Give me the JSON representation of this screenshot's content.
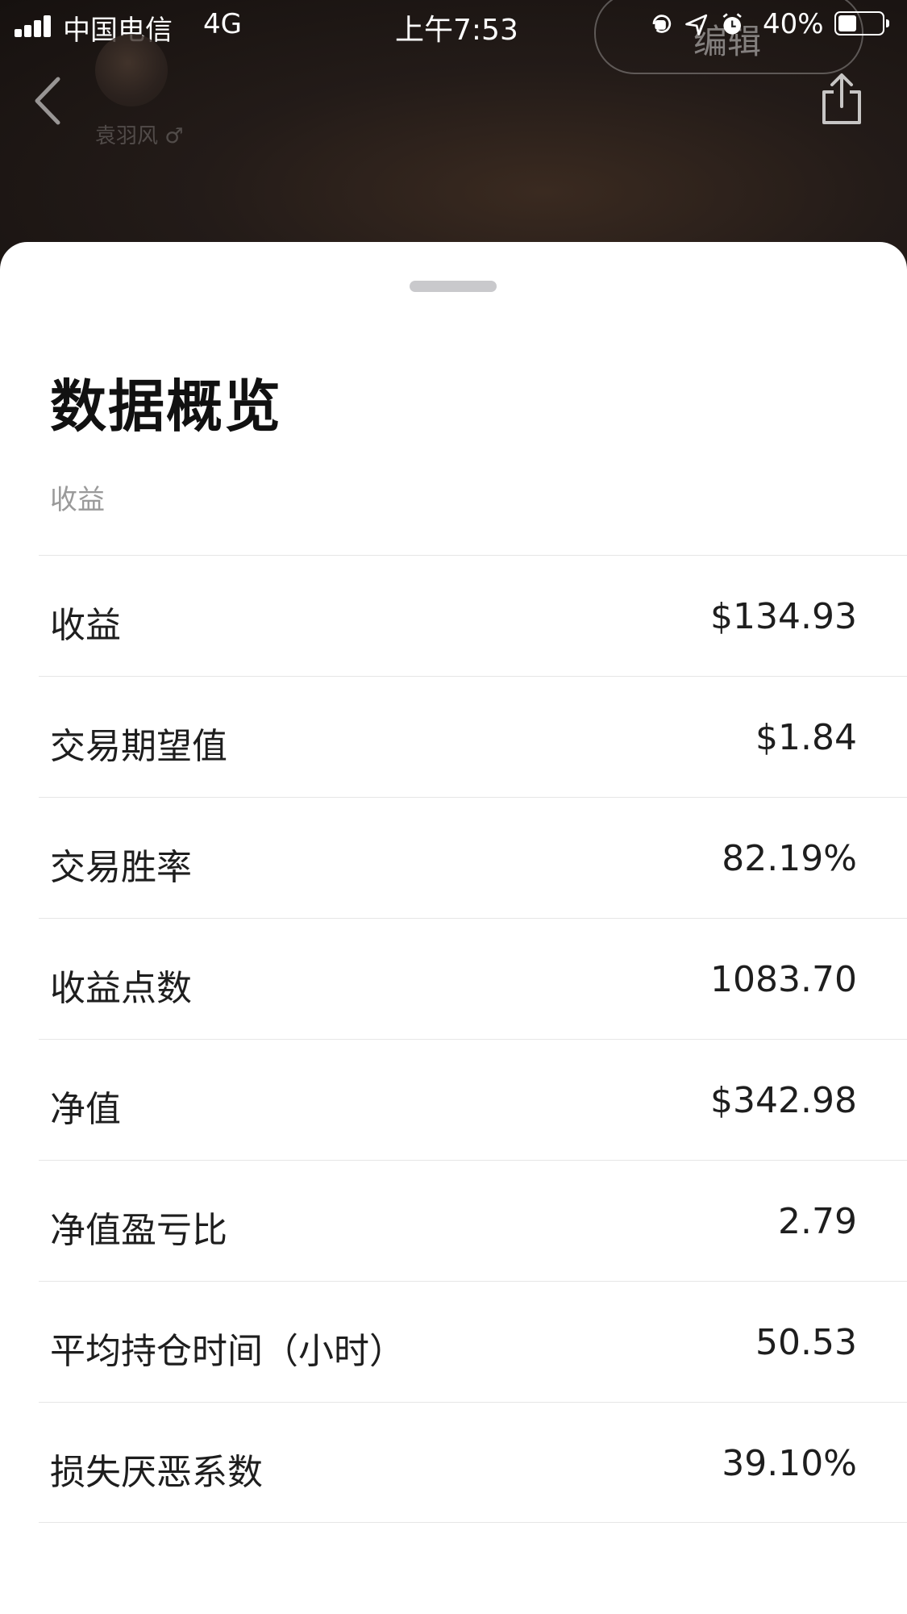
{
  "status_bar": {
    "carrier": "中国电信",
    "network": "4G",
    "time": "上午7:53",
    "battery": "40%"
  },
  "header": {
    "edit_label": "编辑",
    "user_name": "袁羽风 ♂"
  },
  "sheet": {
    "title": "数据概览",
    "section_label": "收益",
    "rows": [
      {
        "label": "收益",
        "value": "$134.93"
      },
      {
        "label": "交易期望值",
        "value": "$1.84"
      },
      {
        "label": "交易胜率",
        "value": "82.19%"
      },
      {
        "label": "收益点数",
        "value": "1083.70"
      },
      {
        "label": "净值",
        "value": "$342.98"
      },
      {
        "label": "净值盈亏比",
        "value": "2.79"
      },
      {
        "label": "平均持仓时间（小时）",
        "value": "50.53"
      },
      {
        "label": "损失厌恶系数",
        "value": "39.10%"
      }
    ]
  }
}
